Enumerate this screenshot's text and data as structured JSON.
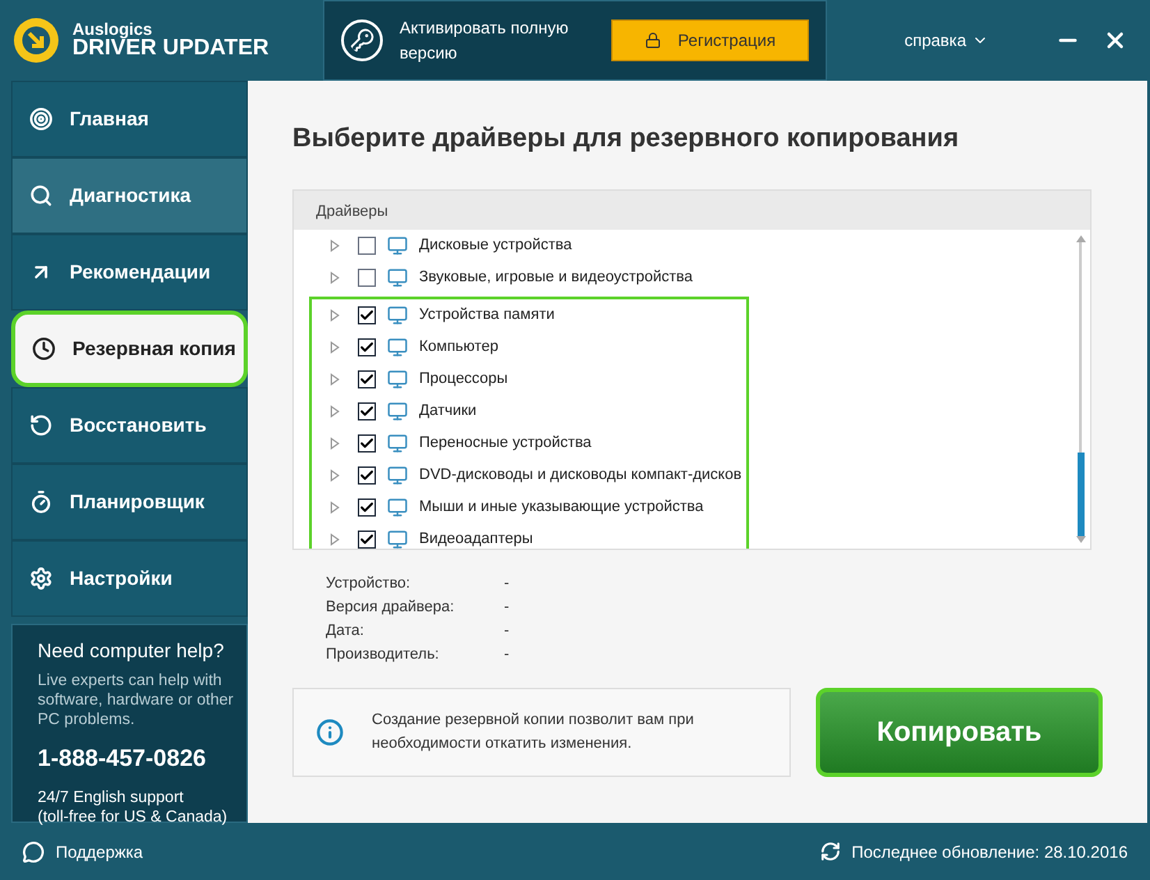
{
  "app": {
    "brand_top": "Auslogics",
    "brand_bottom": "DRIVER UPDATER"
  },
  "activation": {
    "text": "Активировать полную версию",
    "button": "Регистрация"
  },
  "help_menu": "справка",
  "sidebar": {
    "items": [
      {
        "label": "Главная",
        "selected": false,
        "highlighted": false
      },
      {
        "label": "Диагностика",
        "selected": false,
        "highlighted": true
      },
      {
        "label": "Рекомендации",
        "selected": false,
        "highlighted": false
      },
      {
        "label": "Резервная копия",
        "selected": true,
        "highlighted": false
      },
      {
        "label": "Восстановить",
        "selected": false,
        "highlighted": false
      },
      {
        "label": "Планировщик",
        "selected": false,
        "highlighted": false
      },
      {
        "label": "Настройки",
        "selected": false,
        "highlighted": false
      }
    ]
  },
  "help_box": {
    "title": "Need computer help?",
    "text": "Live experts can help with software, hardware or other PC problems.",
    "phone": "1-888-457-0826",
    "note_1": "24/7 English support",
    "note_2": "(toll-free for US & Canada)"
  },
  "heading": "Выберите драйверы для резервного копирования",
  "tree": {
    "header": "Драйверы",
    "groups": [
      {
        "highlighted": false,
        "rows": [
          {
            "label": "Дисковые устройства",
            "checked": false
          },
          {
            "label": "Звуковые, игровые и видеоустройства",
            "checked": false
          }
        ]
      },
      {
        "highlighted": true,
        "rows": [
          {
            "label": "Устройства памяти",
            "checked": true
          },
          {
            "label": "Компьютер",
            "checked": true
          },
          {
            "label": "Процессоры",
            "checked": true
          },
          {
            "label": "Датчики",
            "checked": true
          },
          {
            "label": "Переносные устройства",
            "checked": true
          },
          {
            "label": "DVD-дисководы и дисководы компакт-дисков",
            "checked": true
          },
          {
            "label": "Мыши и иные указывающие устройства",
            "checked": true
          },
          {
            "label": "Видеоадаптеры",
            "checked": true
          }
        ]
      }
    ]
  },
  "details": [
    {
      "label": "Устройство:",
      "value": "-"
    },
    {
      "label": "Версия драйвера:",
      "value": "-"
    },
    {
      "label": "Дата:",
      "value": "-"
    },
    {
      "label": "Производитель:",
      "value": "-"
    }
  ],
  "info": "Создание резервной копии позволит вам при необходимости откатить изменения.",
  "copy_button": {
    "label": "Копировать",
    "highlighted": true
  },
  "footer": {
    "support": "Поддержка",
    "last_update": "Последнее обновление: 28.10.2016"
  }
}
